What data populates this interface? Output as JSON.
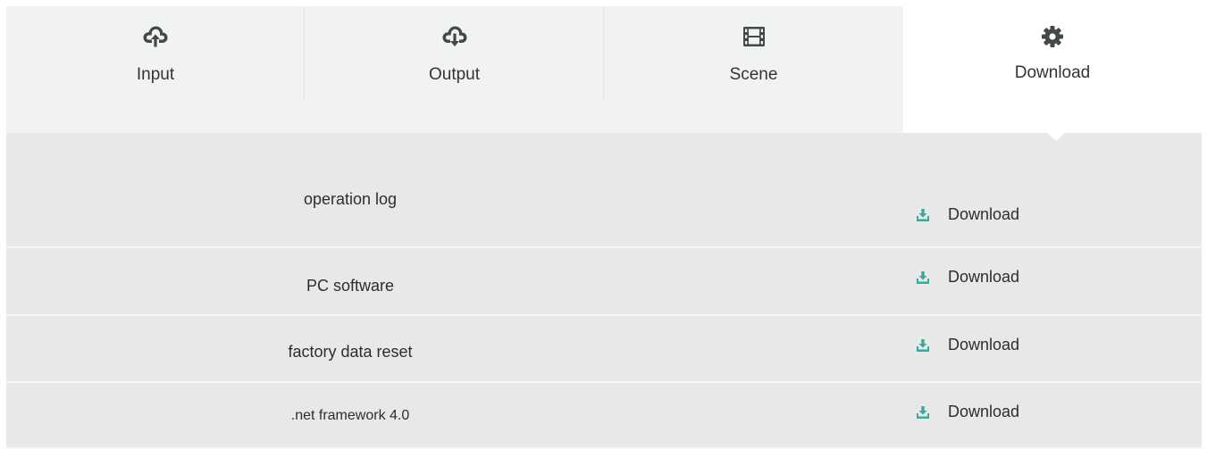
{
  "tabs": [
    {
      "id": "input",
      "label": "Input",
      "icon": "cloud-upload-icon",
      "active": false
    },
    {
      "id": "output",
      "label": "Output",
      "icon": "cloud-download-icon",
      "active": false
    },
    {
      "id": "scene",
      "label": "Scene",
      "icon": "film-icon",
      "active": false
    },
    {
      "id": "download",
      "label": "Download",
      "icon": "gear-icon",
      "active": true
    }
  ],
  "rows": [
    {
      "name": "operation log",
      "action": "Download"
    },
    {
      "name": "PC software",
      "action": "Download"
    },
    {
      "name": "factory data reset",
      "action": "Download"
    },
    {
      "name": ".net framework 4.0",
      "action": "Download"
    }
  ],
  "colors": {
    "icon": "#424a48",
    "download_icon": "#3aa89a",
    "tabbar_bg": "#f1f3f2",
    "content_bg": "#e6e9e7",
    "active_tab_bg": "#ffffff"
  }
}
